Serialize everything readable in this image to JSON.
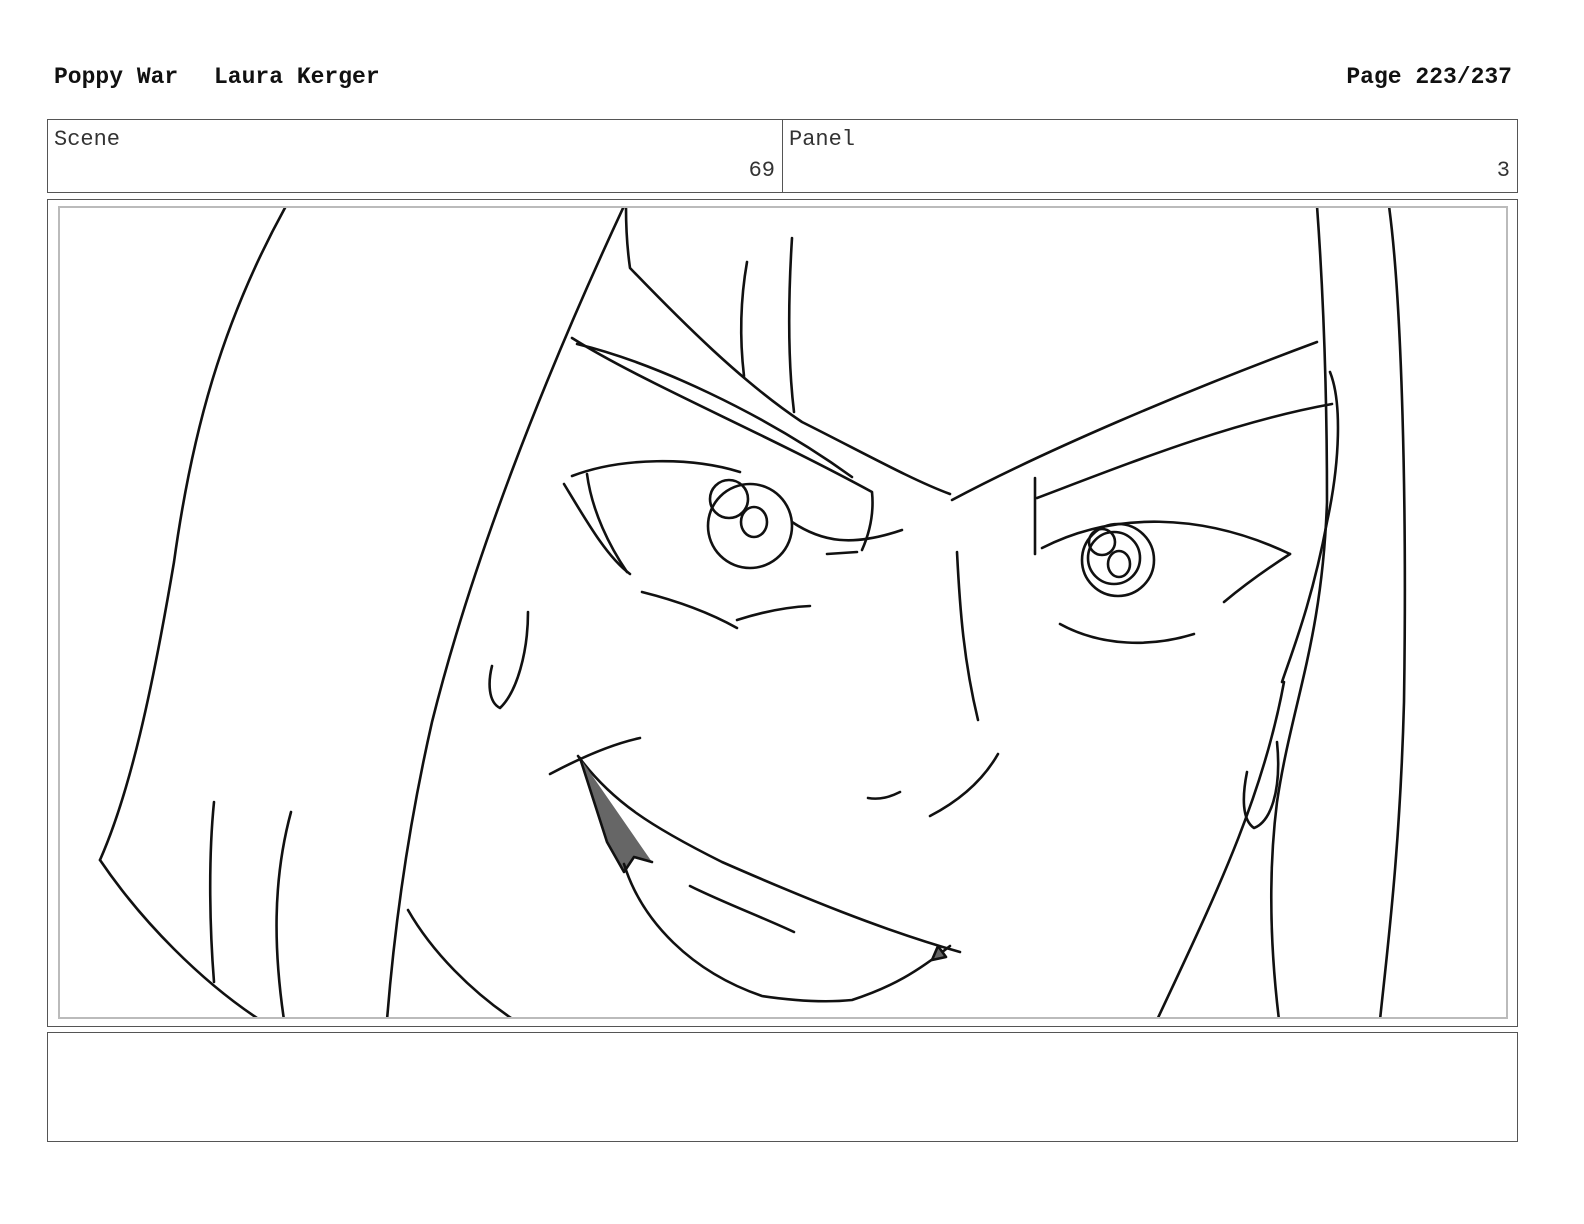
{
  "header": {
    "title": "Poppy War",
    "author": "Laura Kerger",
    "page": "Page 223/237"
  },
  "scene": {
    "label": "Scene",
    "value": "69"
  },
  "panel": {
    "label": "Panel",
    "value": "3"
  },
  "notes": {
    "text": ""
  },
  "colors": {
    "frame_border": "#555555",
    "inner_border": "#bbbbbb",
    "line": "#111111",
    "mouth_shadow": "#666666"
  }
}
